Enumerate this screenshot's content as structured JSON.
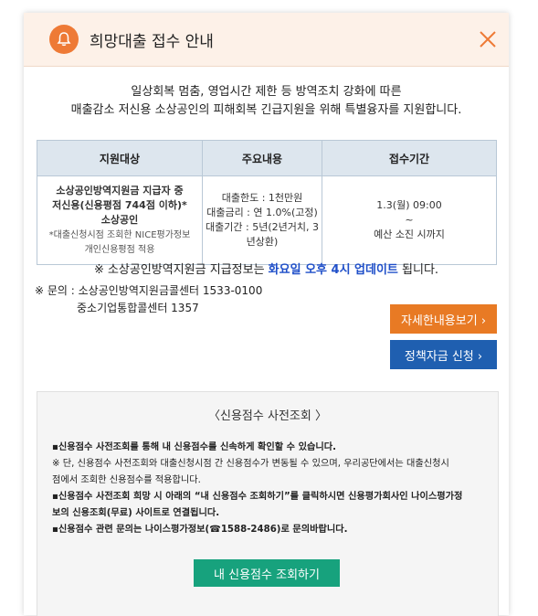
{
  "modal": {
    "title": "희망대출 접수 안내",
    "bell_icon": "bell-icon",
    "close_icon": "close-icon",
    "accent_color": "#ee7a36"
  },
  "intro": {
    "line1": "일상회복 멈춤, 영업시간 제한 등 방역조치 강화에 따른",
    "line2": "매출감소 저신용 소상공인의 피해회복 긴급지원을 위해 특별융자를 지원합니다."
  },
  "table": {
    "headers": [
      "지원대상",
      "주요내용",
      "접수기간"
    ],
    "target": {
      "line1": "소상공인방역지원금 지급자 중",
      "line2": "저신용(신용평점 744점 이하)*",
      "line3": "소상공인",
      "note1": "*대출신청시점 조회한 NICE평가정보",
      "note2": "개인신용평점 적용"
    },
    "content": {
      "line1": "대출한도 : 1천만원",
      "line2": "대출금리 : 연 1.0%(고정)",
      "line3": "대출기간 : 5년(2년거치, 3",
      "line4": "년상환)"
    },
    "period": {
      "line1": "1.3(월) 09:00",
      "line2": "~",
      "line3": "예산 소진 시까지"
    }
  },
  "notice": {
    "prefix": "※ 소상공인방역지원금 지급정보는 ",
    "highlight": "화요일 오후 4시 업데이트",
    "suffix": " 됩니다."
  },
  "contact": {
    "line1": "※ 문의 : 소상공인방역지원금콜센터 1533-0100",
    "line2": "중소기업통합콜센터 1357"
  },
  "buttons": {
    "detail": "자세한내용보기 ›",
    "apply": "정책자금 신청 ›"
  },
  "credit": {
    "title": "〈신용점수 사전조회 〉",
    "line1": "▪신용점수 사전조회를 통해 내 신용점수를 신속하게 확인할 수 있습니다.",
    "line2": "※ 단, 신용점수 사전조회와 대출신청시점 간 신용점수가 변동될 수 있으며, 우리공단에서는 대출신청시",
    "line3": "점에서 조회한 신용점수를 적용합니다.",
    "line4": "▪신용점수 사전조회 희망 시 아래의 “내 신용점수 조회하기”를 클릭하시면 신용평가회사인 나이스평가정",
    "line5": "보의 신용조회(무료) 사이트로 연결됩니다.",
    "line6": "▪신용점수 관련 문의는 나이스평가정보(☎1588-2486)로 문의바랍니다.",
    "button": "내 신용점수 조회하기"
  }
}
